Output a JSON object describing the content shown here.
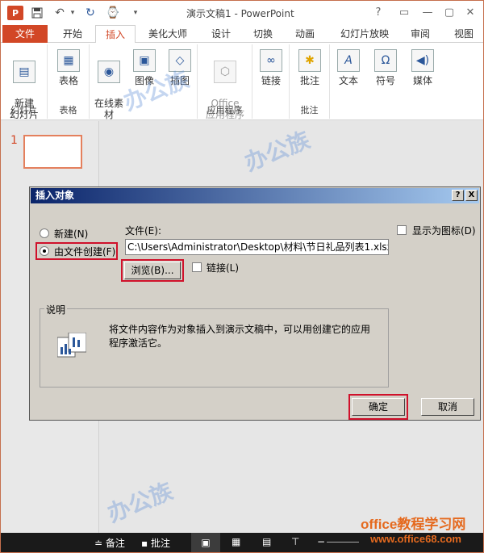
{
  "window": {
    "title": "演示文稿1 - PowerPoint",
    "app_badge": "P",
    "controls": [
      "?",
      "▭",
      "—",
      "▢",
      "✕"
    ]
  },
  "tabs": [
    "文件",
    "开始",
    "插入",
    "美化大师",
    "设计",
    "切换",
    "动画",
    "幻灯片放映",
    "审阅",
    "视图"
  ],
  "ribbon": {
    "new_slide": "新建\n幻灯片",
    "group_slides": "幻灯片",
    "table": "表格",
    "group_table": "表格",
    "online_material": "在线素\n材",
    "image": "图像",
    "illustration": "插图",
    "office_apps": "Office\n应用程序",
    "group_apps": "应用程序",
    "link": "链接",
    "comment": "批注",
    "group_comment": "批注",
    "text": "文本",
    "symbol": "符号",
    "media": "媒体"
  },
  "slides": [
    {
      "number": "1"
    }
  ],
  "dialog": {
    "title": "插入对象",
    "help": "?",
    "close": "X",
    "radio_new": "新建(N)",
    "radio_from_file": "由文件创建(F)",
    "file_label": "文件(E):",
    "file_value": "C:\\Users\\Administrator\\Desktop\\材料\\节日礼品列表1.xlsx",
    "browse": "浏览(B)...",
    "link": "链接(L)",
    "show_icon": "显示为图标(D)",
    "desc_label": "说明",
    "desc_text": "将文件内容作为对象插入到演示文稿中，可以用创建它的应用程序激活它。",
    "ok": "确定",
    "cancel": "取消"
  },
  "status": {
    "notes": "备注",
    "comments": "批注"
  },
  "watermark": {
    "brand": "office教程学习网",
    "url": "www.office68.com",
    "logo_text": "办公族",
    "logo_url": "officezu.com"
  },
  "colors": {
    "accent": "#d24726",
    "dialog_bg": "#d4d0c8",
    "highlight": "#d0112b"
  }
}
